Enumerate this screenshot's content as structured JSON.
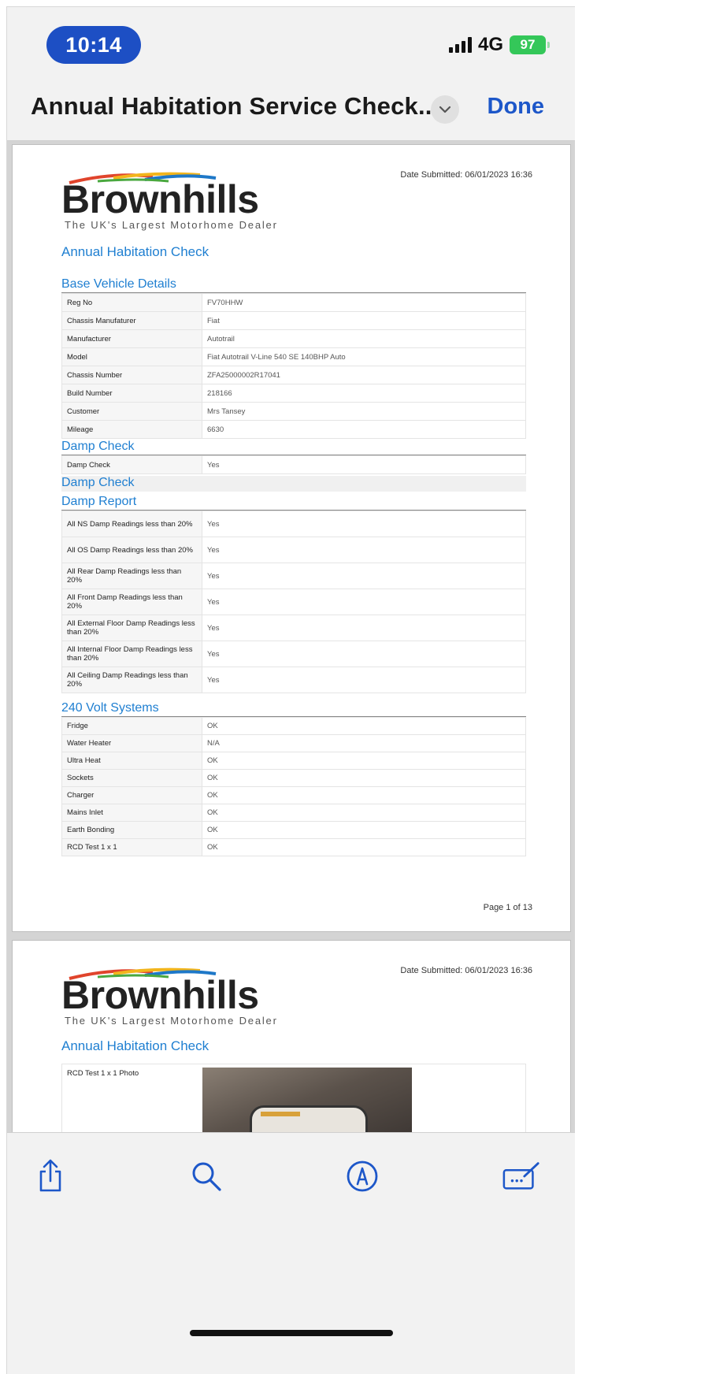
{
  "status": {
    "time": "10:14",
    "network": "4G",
    "battery": "97"
  },
  "nav": {
    "title": "Annual Habitation Service Check...",
    "done_label": "Done"
  },
  "pages": [
    {
      "logo_word": "Brownhills",
      "logo_tagline": "The UK's Largest Motorhome Dealer",
      "date_submitted": "Date Submitted: 06/01/2023 16:36",
      "heading": "Annual Habitation Check",
      "base_title": "Base Vehicle Details",
      "base_rows": [
        {
          "k": "Reg No",
          "v": "FV70HHW"
        },
        {
          "k": "Chassis Manufaturer",
          "v": "Fiat"
        },
        {
          "k": "Manufacturer",
          "v": "Autotrail"
        },
        {
          "k": "Model",
          "v": "Fiat Autotrail V-Line 540 SE 140BHP Auto"
        },
        {
          "k": "Chassis Number",
          "v": "ZFA25000002R17041"
        },
        {
          "k": "Build Number",
          "v": "218166"
        },
        {
          "k": "Customer",
          "v": "Mrs Tansey"
        },
        {
          "k": "Mileage",
          "v": "6630"
        }
      ],
      "damp_title": "Damp Check",
      "damp_rows": [
        {
          "k": "Damp Check",
          "v": "Yes"
        }
      ],
      "damp_check_title2": "Damp Check",
      "damp_report_title": "Damp Report",
      "damp_report_rows": [
        {
          "k": "All NS Damp Readings less than 20%",
          "v": "Yes"
        },
        {
          "k": "All OS Damp Readings less than 20%",
          "v": "Yes"
        },
        {
          "k": "All Rear Damp Readings less than 20%",
          "v": "Yes"
        },
        {
          "k": "All Front Damp Readings less than 20%",
          "v": "Yes"
        },
        {
          "k": "All External Floor Damp Readings less than 20%",
          "v": "Yes"
        },
        {
          "k": "All Internal Floor Damp Readings less than 20%",
          "v": "Yes"
        },
        {
          "k": "All Ceiling Damp Readings less than 20%",
          "v": "Yes"
        }
      ],
      "volt_title": "240 Volt Systems",
      "volt_rows": [
        {
          "k": "Fridge",
          "v": "OK"
        },
        {
          "k": "Water Heater",
          "v": "N/A"
        },
        {
          "k": "Ultra Heat",
          "v": "OK"
        },
        {
          "k": "Sockets",
          "v": "OK"
        },
        {
          "k": "Charger",
          "v": "OK"
        },
        {
          "k": "Mains Inlet",
          "v": "OK"
        },
        {
          "k": "Earth Bonding",
          "v": "OK"
        },
        {
          "k": "RCD Test 1 x 1",
          "v": "OK"
        }
      ],
      "page_number": "Page 1 of 13"
    },
    {
      "logo_word": "Brownhills",
      "logo_tagline": "The UK's Largest Motorhome Dealer",
      "date_submitted": "Date Submitted: 06/01/2023 16:36",
      "heading": "Annual Habitation Check",
      "photo_label": "RCD Test 1 x 1 Photo"
    }
  ],
  "icons": [
    "share-icon",
    "search-icon",
    "markup-icon",
    "signature-icon",
    "chevron-down-icon"
  ],
  "colors": {
    "accent": "#1d57c9",
    "time_pill": "#1d4fc4",
    "heading_blue": "#1f7fd1",
    "battery": "#34c759"
  }
}
